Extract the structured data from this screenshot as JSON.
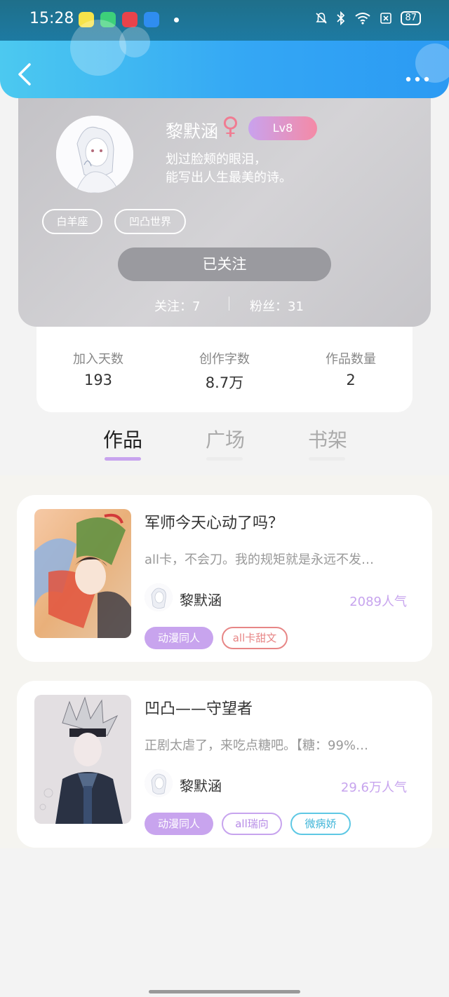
{
  "status_bar": {
    "time": "15:28",
    "battery": "87",
    "icons": [
      "mute-icon",
      "bluetooth-icon",
      "wifi-icon",
      "sim-icon",
      "battery-icon"
    ]
  },
  "header": {
    "back_icon": "chevron-left-icon",
    "more_icon": "more-dots-icon"
  },
  "profile": {
    "name": "黎默涵",
    "gender_symbol": "♀",
    "level": "Lv8",
    "bio_line1": "划过脸颊的眼泪，",
    "bio_line2": "能写出人生最美的诗。",
    "tags": [
      "白羊座",
      "凹凸世界"
    ],
    "follow_button": "已关注",
    "following_label": "关注：7",
    "fans_label": "粉丝：31"
  },
  "stats": [
    {
      "label": "加入天数",
      "value": "193"
    },
    {
      "label": "创作字数",
      "value": "8.7万"
    },
    {
      "label": "作品数量",
      "value": "2"
    }
  ],
  "tabs": [
    {
      "label": "作品",
      "active": true
    },
    {
      "label": "广场",
      "active": false
    },
    {
      "label": "书架",
      "active": false
    }
  ],
  "works": [
    {
      "title": "军师今天心动了吗？",
      "description": "all卡，不会刀。我的规矩就是永远不发…",
      "author": "黎默涵",
      "popularity": "2089人气",
      "tags": [
        {
          "label": "动漫同人",
          "style": "filled"
        },
        {
          "label": "all卡甜文",
          "style": "red"
        }
      ]
    },
    {
      "title": "凹凸——守望者",
      "description": "正剧太虐了，来吃点糖吧。【糖：99%…",
      "author": "黎默涵",
      "popularity": "29.6万人气",
      "tags": [
        {
          "label": "动漫同人",
          "style": "filled"
        },
        {
          "label": "all瑞向",
          "style": "purple"
        },
        {
          "label": "微病娇",
          "style": "cyan"
        }
      ]
    }
  ],
  "colors": {
    "header_gradient_start": "#4cc9f0",
    "header_gradient_end": "#2b9af3",
    "accent_purple": "#c8a4ee",
    "gender_pink": "#f07c92"
  }
}
